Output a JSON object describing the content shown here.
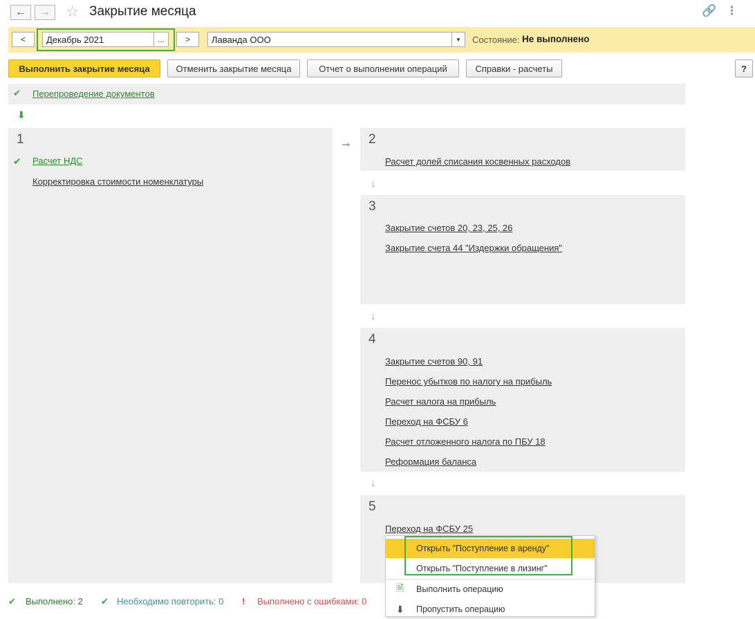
{
  "header": {
    "back_icon": "arrow-left-icon",
    "forward_icon": "arrow-right-icon",
    "title": "Закрытие месяца",
    "favorite_icon": "star-icon",
    "link_icon": "link-icon",
    "more_icon": "more-vertical-icon"
  },
  "period": {
    "prev": "<",
    "value": "Декабрь 2021",
    "picker": "...",
    "next": ">",
    "organization": "Лаванда ООО",
    "status_label": "Состояние:",
    "status_value": "Не выполнено"
  },
  "toolbar": {
    "run": "Выполнить закрытие месяца",
    "cancel": "Отменить закрытие месяца",
    "report": "Отчет о выполнении операций",
    "help_calc": "Справки - расчеты",
    "help": "?"
  },
  "reposting": {
    "label": "Перепроведение документов"
  },
  "steps": {
    "s1": {
      "num": "1",
      "items": [
        "Расчет НДС",
        "Корректировка стоимости номенклатуры"
      ]
    },
    "s2": {
      "num": "2",
      "items": [
        "Расчет долей списания косвенных расходов"
      ]
    },
    "s3": {
      "num": "3",
      "items": [
        "Закрытие счетов 20, 23, 25, 26",
        "Закрытие счета 44 \"Издержки обращения\""
      ]
    },
    "s4": {
      "num": "4",
      "items": [
        "Закрытие счетов 90, 91",
        "Перенос убытков по налогу на прибыль",
        "Расчет налога на прибыль",
        "Переход на ФСБУ 6",
        "Расчет отложенного налога по ПБУ 18",
        "Реформация баланса"
      ]
    },
    "s5": {
      "num": "5",
      "items": [
        "Переход на ФСБУ 25"
      ]
    }
  },
  "context_menu": {
    "items": [
      "Открыть \"Поступление в аренду\"",
      "Открыть \"Поступление в лизинг\"",
      "Выполнить операцию",
      "Пропустить операцию"
    ]
  },
  "footer": {
    "done": "Выполнено: 2",
    "repeat": "Необходимо повторить: 0",
    "errors": "Выполнено с ошибками: 0"
  },
  "colors": {
    "accent_yellow": "#f8d32f",
    "period_bar": "#fbeca8",
    "highlight_green": "#43ad41",
    "error_red": "#e24a4a",
    "repeat_teal": "#3a8fa0"
  }
}
